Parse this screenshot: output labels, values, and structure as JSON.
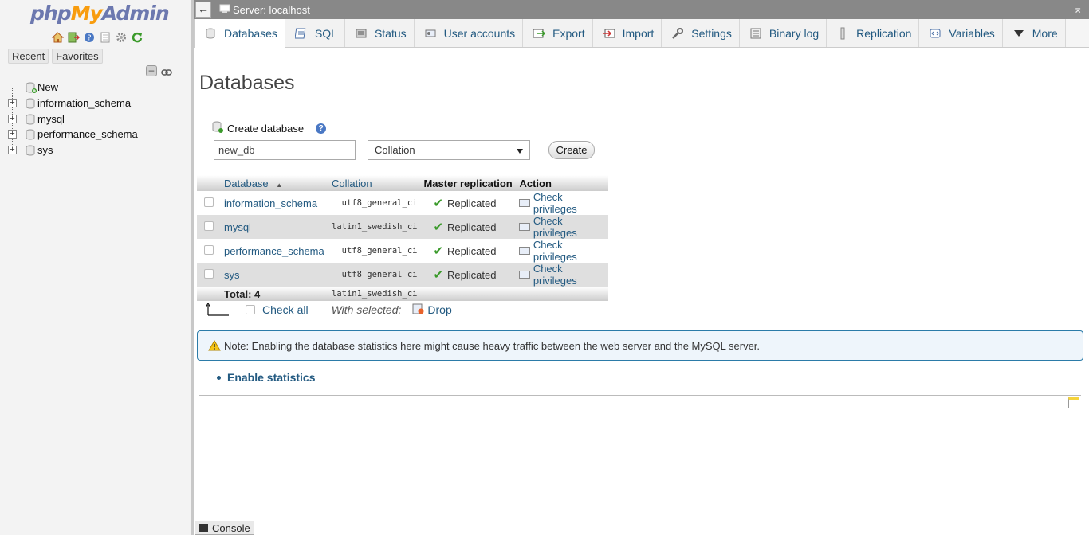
{
  "nav": {
    "logo": {
      "php": "php",
      "my": "My",
      "admin": "Admin"
    },
    "icons": [
      "home-icon",
      "logout-icon",
      "help-icon",
      "docs-icon",
      "settings-icon",
      "reload-icon"
    ],
    "tabs": [
      "Recent",
      "Favorites"
    ],
    "tree": [
      {
        "label": "New",
        "type": "new"
      },
      {
        "label": "information_schema",
        "type": "db"
      },
      {
        "label": "mysql",
        "type": "db"
      },
      {
        "label": "performance_schema",
        "type": "db"
      },
      {
        "label": "sys",
        "type": "db"
      }
    ]
  },
  "topbar": {
    "back_label": "←",
    "server": "Server: localhost",
    "collapse": "⌅"
  },
  "tabs": [
    {
      "label": "Databases",
      "icon": "database-icon",
      "active": true
    },
    {
      "label": "SQL",
      "icon": "sql-icon"
    },
    {
      "label": "Status",
      "icon": "status-icon"
    },
    {
      "label": "User accounts",
      "icon": "users-icon"
    },
    {
      "label": "Export",
      "icon": "export-icon"
    },
    {
      "label": "Import",
      "icon": "import-icon"
    },
    {
      "label": "Settings",
      "icon": "wrench-icon"
    },
    {
      "label": "Binary log",
      "icon": "binlog-icon"
    },
    {
      "label": "Replication",
      "icon": "replication-icon"
    },
    {
      "label": "Variables",
      "icon": "variables-icon"
    },
    {
      "label": "More",
      "icon": "triangle-down-icon"
    }
  ],
  "page": {
    "title": "Databases",
    "create": {
      "label": "Create database",
      "name_value": "new_db",
      "collation_value": "Collation",
      "button": "Create"
    },
    "table": {
      "headers": {
        "database": "Database",
        "sort_indicator": "▲",
        "collation": "Collation",
        "master_replication": "Master replication",
        "action": "Action"
      },
      "rows": [
        {
          "name": "information_schema",
          "collation": "utf8_general_ci",
          "replication": "Replicated",
          "action": "Check privileges"
        },
        {
          "name": "mysql",
          "collation": "latin1_swedish_ci",
          "replication": "Replicated",
          "action": "Check privileges"
        },
        {
          "name": "performance_schema",
          "collation": "utf8_general_ci",
          "replication": "Replicated",
          "action": "Check privileges"
        },
        {
          "name": "sys",
          "collation": "utf8_general_ci",
          "replication": "Replicated",
          "action": "Check privileges"
        }
      ],
      "total_label": "Total: 4",
      "total_collation": "latin1_swedish_ci"
    },
    "bulk": {
      "check_all": "Check all",
      "with_selected": "With selected:",
      "drop": "Drop"
    },
    "notice": "Note: Enabling the database statistics here might cause heavy traffic between the web server and the MySQL server.",
    "enable_stats": "Enable statistics"
  },
  "console": {
    "label": "Console"
  },
  "colors": {
    "link": "#235a81",
    "accent": "#f89c0e",
    "notice_border": "#2b7ba8"
  }
}
